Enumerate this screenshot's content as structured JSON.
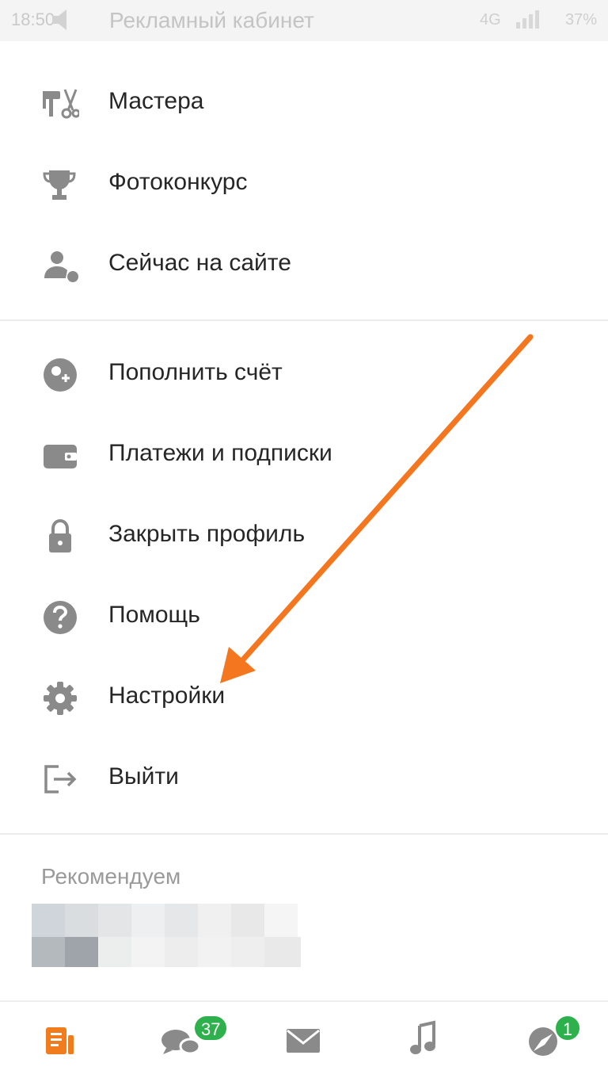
{
  "status_bar": {
    "time": "18:50",
    "title": "Рекламный кабинет",
    "network": "4G",
    "battery": "37%"
  },
  "menu": {
    "group1": [
      {
        "label": "Мастера",
        "icon": "paint-roller-scissors-icon"
      },
      {
        "label": "Фотоконкурс",
        "icon": "trophy-icon"
      },
      {
        "label": "Сейчас на сайте",
        "icon": "user-online-icon"
      }
    ],
    "group2": [
      {
        "label": "Пополнить счёт",
        "icon": "coins-plus-icon"
      },
      {
        "label": "Платежи и подписки",
        "icon": "wallet-icon"
      },
      {
        "label": "Закрыть профиль",
        "icon": "lock-icon"
      },
      {
        "label": "Помощь",
        "icon": "help-icon"
      },
      {
        "label": "Настройки",
        "icon": "gear-icon"
      },
      {
        "label": "Выйти",
        "icon": "logout-icon"
      }
    ]
  },
  "recommend": {
    "title": "Рекомендуем"
  },
  "bottom_nav": {
    "items": [
      {
        "icon": "feed-icon"
      },
      {
        "icon": "chat-icon",
        "badge": "37"
      },
      {
        "icon": "mail-icon"
      },
      {
        "icon": "music-icon"
      },
      {
        "icon": "discussions-icon",
        "badge": "1"
      }
    ]
  },
  "colors": {
    "accent_orange": "#f07c1d",
    "badge_green": "#2eb14c",
    "icon_gray": "#8a8a8a",
    "arrow": "#f47720"
  }
}
